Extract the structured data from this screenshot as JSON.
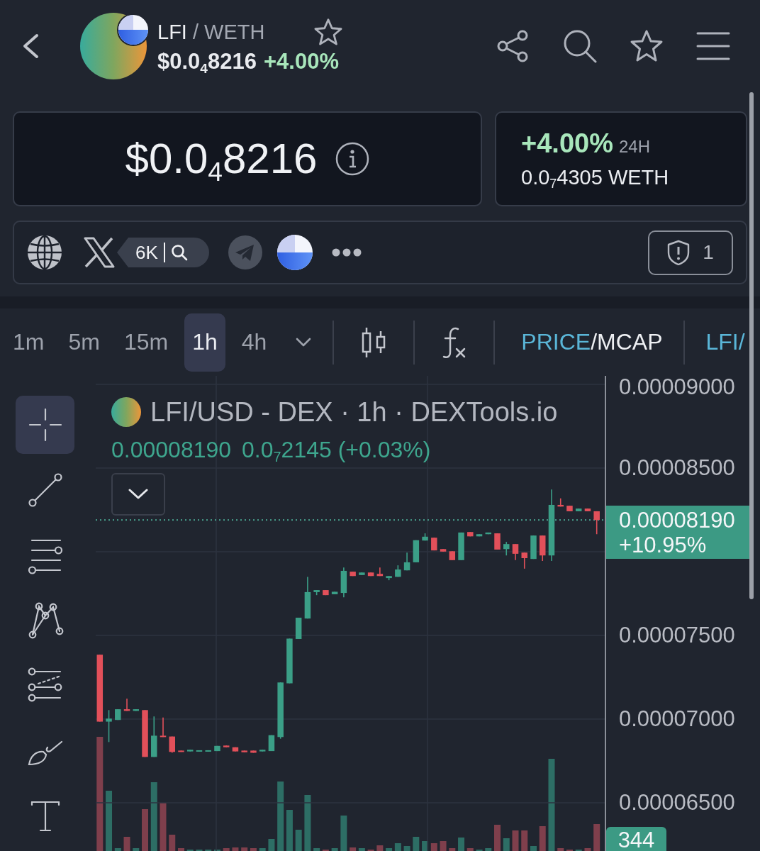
{
  "header": {
    "base": "LFI",
    "quote": "/ WETH",
    "price": "$0.0$_{4}$8216",
    "change": "+4.00%"
  },
  "price_card": {
    "price": "$0.0$_{4}$8216"
  },
  "change_card": {
    "change": "+4.00%",
    "period": "24H",
    "quote_price": "0.0$_{7}$4305 WETH"
  },
  "links": {
    "followers": "6K",
    "warnings": "1"
  },
  "toolbar": {
    "timeframes": [
      {
        "label": "1m",
        "selected": false
      },
      {
        "label": "5m",
        "selected": false
      },
      {
        "label": "15m",
        "selected": false
      },
      {
        "label": "1h",
        "selected": true
      },
      {
        "label": "4h",
        "selected": false
      }
    ],
    "display_modes": [
      {
        "label": "PRICE",
        "selected": true
      },
      {
        "label": "MCAP",
        "selected": false
      }
    ],
    "separator": "/",
    "pair_toggle": "LFI/"
  },
  "tools": [
    {
      "kind": "crosshair",
      "selected": true
    },
    {
      "kind": "trendline",
      "selected": false
    },
    {
      "kind": "channel",
      "selected": false
    },
    {
      "kind": "pattern",
      "selected": false
    },
    {
      "kind": "fibonacci",
      "selected": false
    },
    {
      "kind": "brush",
      "selected": false
    },
    {
      "kind": "text",
      "selected": false
    }
  ],
  "chart": {
    "title": "LFI/USD - DEX · 1h · DEXTools.io",
    "last": "0.00008190",
    "change": "0.0$_{7}$2145 (+0.03%)",
    "chart_data": {
      "type": "candlestick",
      "grid": true,
      "ohlc": [
        [
          7.385e-05,
          7.385e-05,
          6.985e-05,
          6.985e-05
        ],
        [
          6.985e-05,
          7.054e-05,
          6.863e-05,
          7.003e-05
        ],
        [
          6.995e-05,
          7.059e-05,
          6.995e-05,
          7.059e-05
        ],
        [
          7.059e-05,
          7.122e-05,
          7.049e-05,
          7.049e-05
        ],
        [
          7.049e-05,
          7.059e-05,
          7.049e-05,
          7.059e-05
        ],
        [
          7.054e-05,
          7.054e-05,
          6.774e-05,
          6.774e-05
        ],
        [
          6.774e-05,
          7.016e-05,
          6.774e-05,
          6.901e-05
        ],
        [
          6.901e-05,
          7.01e-05,
          6.893e-05,
          6.893e-05
        ],
        [
          6.896e-05,
          6.896e-05,
          6.799e-05,
          6.804e-05
        ],
        [
          6.812e-05,
          6.812e-05,
          6.804e-05,
          6.804e-05
        ],
        [
          6.807e-05,
          6.817e-05,
          6.807e-05,
          6.817e-05
        ],
        [
          6.807e-05,
          6.814e-05,
          6.807e-05,
          6.814e-05
        ],
        [
          6.807e-05,
          6.814e-05,
          6.807e-05,
          6.814e-05
        ],
        [
          6.809e-05,
          6.84e-05,
          6.809e-05,
          6.84e-05
        ],
        [
          6.842e-05,
          6.842e-05,
          6.832e-05,
          6.832e-05
        ],
        [
          6.832e-05,
          6.832e-05,
          6.807e-05,
          6.807e-05
        ],
        [
          6.812e-05,
          6.812e-05,
          6.802e-05,
          6.802e-05
        ],
        [
          6.812e-05,
          6.812e-05,
          6.799e-05,
          6.799e-05
        ],
        [
          6.807e-05,
          6.817e-05,
          6.807e-05,
          6.817e-05
        ],
        [
          6.809e-05,
          6.904e-05,
          6.809e-05,
          6.904e-05
        ],
        [
          6.893e-05,
          7.219e-05,
          6.883e-05,
          7.219e-05
        ],
        [
          7.214e-05,
          7.481e-05,
          7.214e-05,
          7.481e-05
        ],
        [
          7.479e-05,
          7.606e-05,
          7.479e-05,
          7.606e-05
        ],
        [
          7.601e-05,
          7.85e-05,
          7.601e-05,
          7.759e-05
        ],
        [
          7.759e-05,
          7.771e-05,
          7.741e-05,
          7.771e-05
        ],
        [
          7.771e-05,
          7.771e-05,
          7.741e-05,
          7.741e-05
        ],
        [
          7.746e-05,
          7.761e-05,
          7.746e-05,
          7.761e-05
        ],
        [
          7.754e-05,
          7.906e-05,
          7.728e-05,
          7.886e-05
        ],
        [
          7.881e-05,
          7.881e-05,
          7.855e-05,
          7.855e-05
        ],
        [
          7.861e-05,
          7.876e-05,
          7.861e-05,
          7.876e-05
        ],
        [
          7.876e-05,
          7.876e-05,
          7.855e-05,
          7.855e-05
        ],
        [
          7.868e-05,
          7.906e-05,
          7.855e-05,
          7.855e-05
        ],
        [
          7.843e-05,
          7.855e-05,
          7.83e-05,
          7.855e-05
        ],
        [
          7.85e-05,
          7.919e-05,
          7.85e-05,
          7.894e-05
        ],
        [
          7.889e-05,
          7.995e-05,
          7.889e-05,
          7.937e-05
        ],
        [
          7.937e-05,
          8.069e-05,
          7.937e-05,
          8.069e-05
        ],
        [
          8.067e-05,
          8.11e-05,
          8.067e-05,
          8.09e-05
        ],
        [
          8.084e-05,
          8.084e-05,
          8.008e-05,
          8.008e-05
        ],
        [
          8.016e-05,
          8.016e-05,
          8.001e-05,
          8.001e-05
        ],
        [
          8.003e-05,
          8.003e-05,
          7.95e-05,
          7.95e-05
        ],
        [
          7.95e-05,
          8.115e-05,
          7.95e-05,
          8.115e-05
        ],
        [
          8.118e-05,
          8.118e-05,
          8.092e-05,
          8.092e-05
        ],
        [
          8.092e-05,
          8.105e-05,
          8.092e-05,
          8.105e-05
        ],
        [
          8.105e-05,
          8.115e-05,
          8.105e-05,
          8.115e-05
        ],
        [
          8.11e-05,
          8.11e-05,
          8.013e-05,
          8.013e-05
        ],
        [
          8.016e-05,
          8.059e-05,
          7.978e-05,
          8.046e-05
        ],
        [
          8.046e-05,
          8.046e-05,
          7.95e-05,
          7.988e-05
        ],
        [
          7.995e-05,
          7.995e-05,
          7.899e-05,
          7.962e-05
        ],
        [
          7.957e-05,
          8.097e-05,
          7.957e-05,
          8.097e-05
        ],
        [
          8.097e-05,
          8.097e-05,
          7.945e-05,
          7.978e-05
        ],
        [
          7.978e-05,
          8.372e-05,
          7.945e-05,
          8.28e-05
        ],
        [
          8.28e-05,
          8.319e-05,
          8.27e-05,
          8.27e-05
        ],
        [
          8.275e-05,
          8.275e-05,
          8.242e-05,
          8.242e-05
        ],
        [
          8.242e-05,
          8.258e-05,
          8.242e-05,
          8.258e-05
        ],
        [
          8.258e-05,
          8.258e-05,
          8.242e-05,
          8.242e-05
        ],
        [
          8.242e-05,
          8.242e-05,
          8.105e-05,
          8.19e-05
        ]
      ],
      "ylim": [
        6.212e-05,
        9.051e-05
      ],
      "yticks": [
        {
          "value": 9e-05,
          "label": "0.00009000"
        },
        {
          "value": 8.5e-05,
          "label": "0.00008500"
        },
        {
          "value": 7.5e-05,
          "label": "0.00007500"
        },
        {
          "value": 7e-05,
          "label": "0.00007000"
        },
        {
          "value": 6.5e-05,
          "label": "0.00006500"
        }
      ],
      "ref_lines": [
        {
          "axis": "y",
          "value": 8.19e-05
        }
      ]
    },
    "price_tag": {
      "price": "0.00008190",
      "change": "+10.95%"
    },
    "volume_tag": "344"
  }
}
